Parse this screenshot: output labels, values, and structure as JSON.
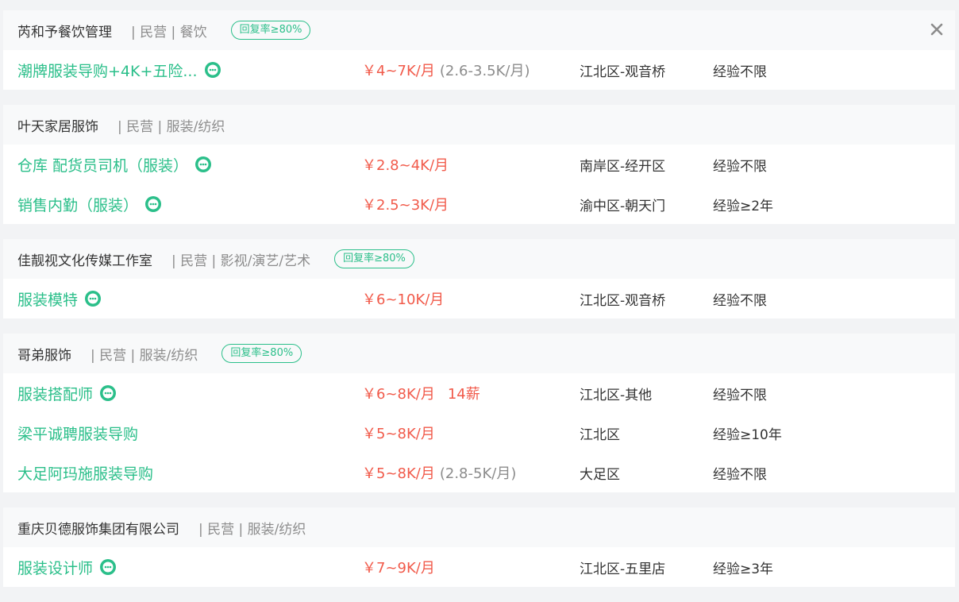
{
  "colors": {
    "accent_green": "#2bbf8a",
    "salary_red": "#f15a4a",
    "muted_gray": "#8c8c8c",
    "page_bg": "#f2f3f5"
  },
  "icons": {
    "close": "close-icon",
    "chat": "chat-bubble-icon"
  },
  "companies": [
    {
      "name": "芮和予餐饮管理",
      "meta": "| 民营 | 餐饮",
      "badge": "回复率≥80%",
      "jobs": [
        {
          "title": "潮牌服装导购+4K+五险...",
          "salary": "￥4~7K/月",
          "salary_extra": "(2.6-3.5K/月)",
          "bonus": "",
          "location": "江北区-观音桥",
          "experience": "经验不限",
          "chat": true
        }
      ]
    },
    {
      "name": "叶天家居服饰",
      "meta": "| 民营 | 服装/纺织",
      "badge": "",
      "jobs": [
        {
          "title": "仓库 配货员司机（服装）",
          "salary": "￥2.8~4K/月",
          "salary_extra": "",
          "bonus": "",
          "location": "南岸区-经开区",
          "experience": "经验不限",
          "chat": true
        },
        {
          "title": "销售内勤（服装）",
          "salary": "￥2.5~3K/月",
          "salary_extra": "",
          "bonus": "",
          "location": "渝中区-朝天门",
          "experience": "经验≥2年",
          "chat": true
        }
      ]
    },
    {
      "name": "佳靓视文化传媒工作室",
      "meta": "| 民营 | 影视/演艺/艺术",
      "badge": "回复率≥80%",
      "jobs": [
        {
          "title": "服装模特",
          "salary": "￥6~10K/月",
          "salary_extra": "",
          "bonus": "",
          "location": "江北区-观音桥",
          "experience": "经验不限",
          "chat": true
        }
      ]
    },
    {
      "name": "哥弟服饰",
      "meta": "| 民营 | 服装/纺织",
      "badge": "回复率≥80%",
      "jobs": [
        {
          "title": "服装搭配师",
          "salary": "￥6~8K/月",
          "salary_extra": "",
          "bonus": "14薪",
          "location": "江北区-其他",
          "experience": "经验不限",
          "chat": true
        },
        {
          "title": "梁平诚聘服装导购",
          "salary": "￥5~8K/月",
          "salary_extra": "",
          "bonus": "",
          "location": "江北区",
          "experience": "经验≥10年",
          "chat": false
        },
        {
          "title": "大足阿玛施服装导购",
          "salary": "￥5~8K/月",
          "salary_extra": "(2.8-5K/月)",
          "bonus": "",
          "location": "大足区",
          "experience": "经验不限",
          "chat": false
        }
      ]
    },
    {
      "name": "重庆贝德服饰集团有限公司",
      "meta": "| 民营 | 服装/纺织",
      "badge": "",
      "jobs": [
        {
          "title": "服装设计师",
          "salary": "￥7~9K/月",
          "salary_extra": "",
          "bonus": "",
          "location": "江北区-五里店",
          "experience": "经验≥3年",
          "chat": true
        }
      ]
    }
  ]
}
